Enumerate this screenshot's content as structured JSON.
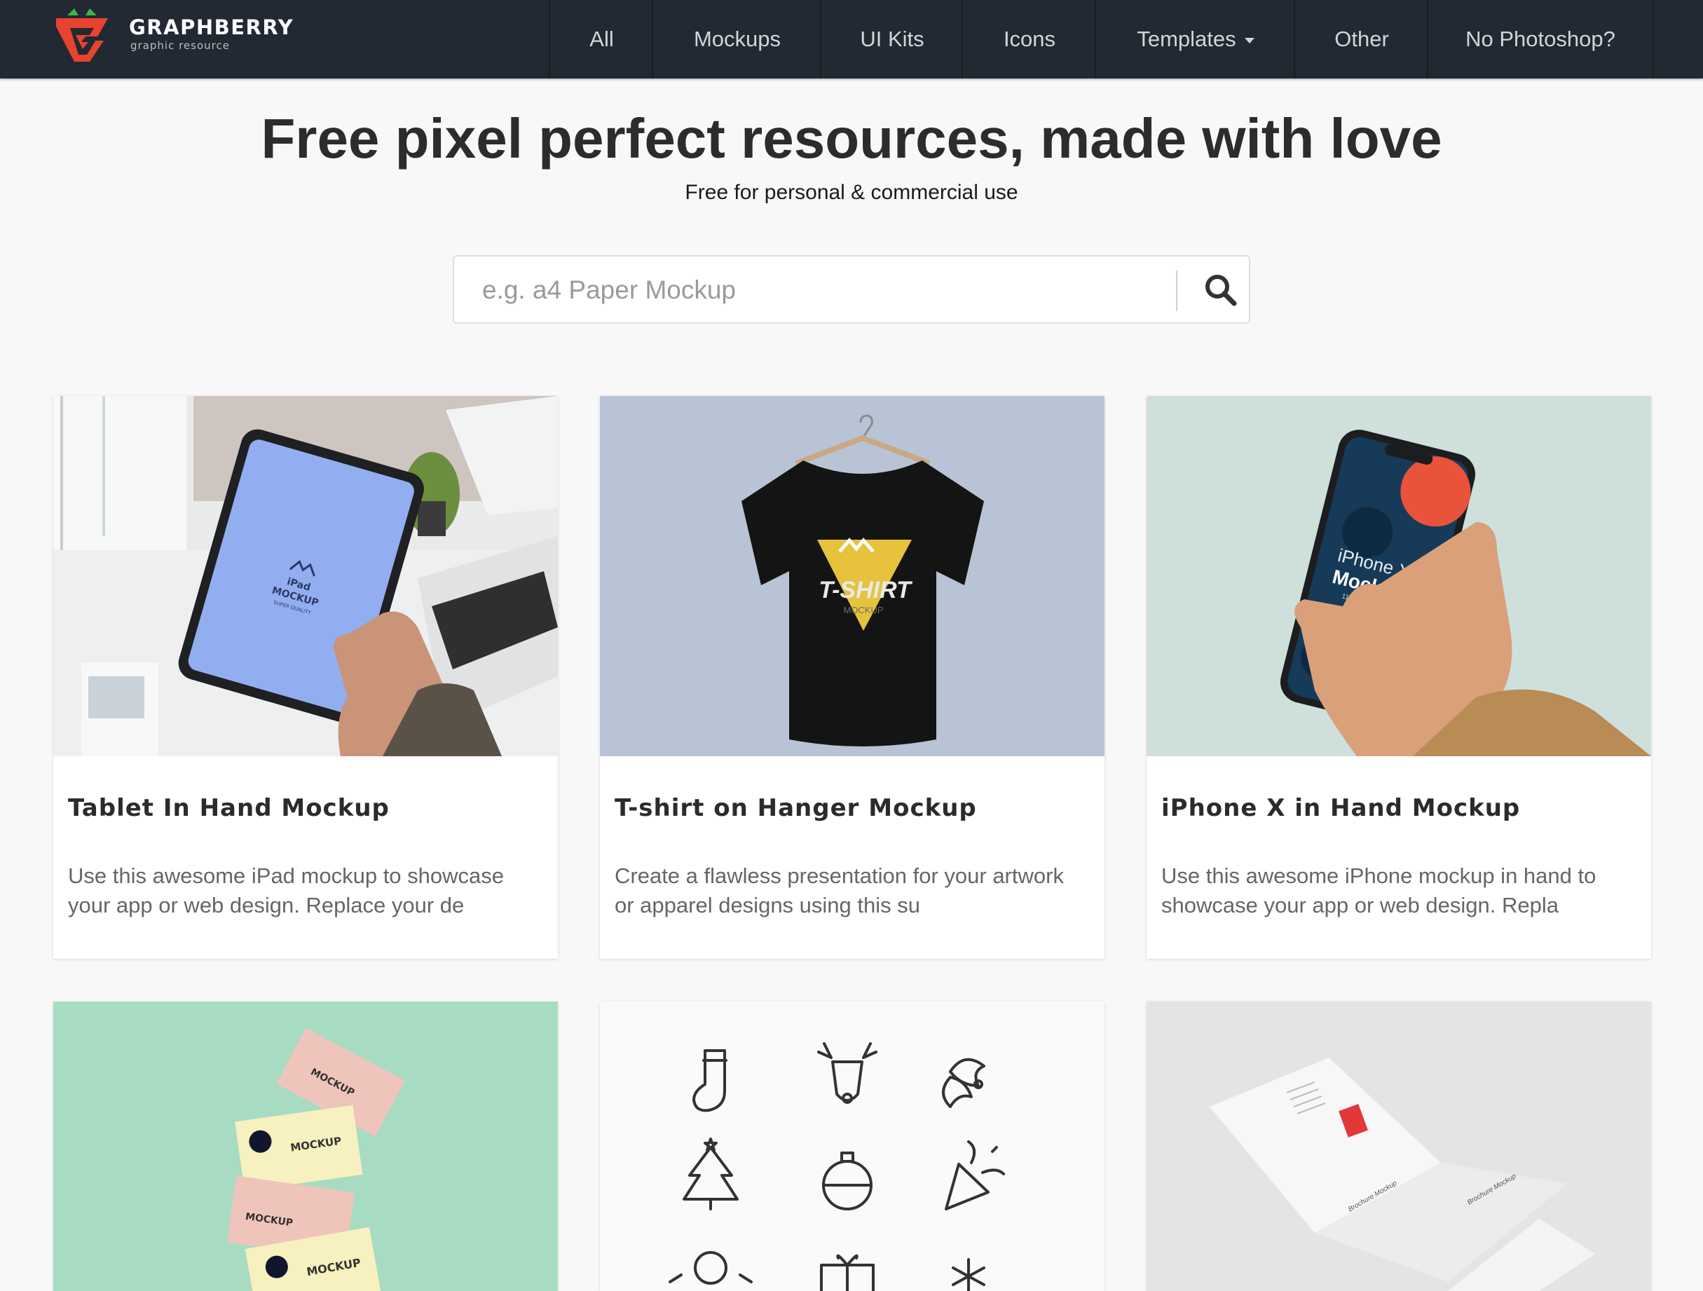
{
  "brand": {
    "name": "GRAPHBERRY",
    "tagline": "graphic resource"
  },
  "nav": {
    "all": "All",
    "mockups": "Mockups",
    "ui_kits": "UI Kits",
    "icons": "Icons",
    "templates": "Templates",
    "other": "Other",
    "no_photoshop": "No Photoshop?"
  },
  "hero": {
    "title": "Free pixel perfect resources, made with love",
    "subtitle": "Free for personal & commercial use"
  },
  "search": {
    "placeholder": "e.g. a4 Paper Mockup",
    "value": ""
  },
  "cards": [
    {
      "title": "Tablet In Hand Mockup",
      "description": "Use this awesome iPad mockup to showcase your app or web design. Replace your de",
      "image_text": {
        "device": "iPad",
        "label": "MOCKUP",
        "note": "SUPER QUALITY"
      }
    },
    {
      "title": "T-shirt on Hanger Mockup",
      "description": "Create a flawless presentation for your artwork or apparel designs using this su",
      "image_text": {
        "label": "T-SHIRT",
        "sub": "MOCKUP"
      }
    },
    {
      "title": "iPhone X in Hand Mockup",
      "description": "Use this awesome iPhone mockup in hand to showcase your app or web design. Repla",
      "image_text": {
        "device": "iPhone X",
        "label": "Mockup",
        "note": "1125x2436px"
      }
    },
    {
      "image_text": {
        "label": "MOCKUP"
      }
    },
    {
      "image_icons": [
        "stocking-icon",
        "reindeer-icon",
        "holly-icon",
        "christmas-tree-icon",
        "ornament-icon",
        "party-popper-icon",
        "snowman-icon",
        "gift-icon",
        "snowflake-icon"
      ]
    },
    {
      "image_text": {
        "label": "Brochure Mockup"
      }
    }
  ],
  "colors": {
    "navbar": "#222932",
    "page_bg": "#f8f8f8",
    "brand_red": "#e8432e",
    "brand_green": "#3ab54a"
  }
}
